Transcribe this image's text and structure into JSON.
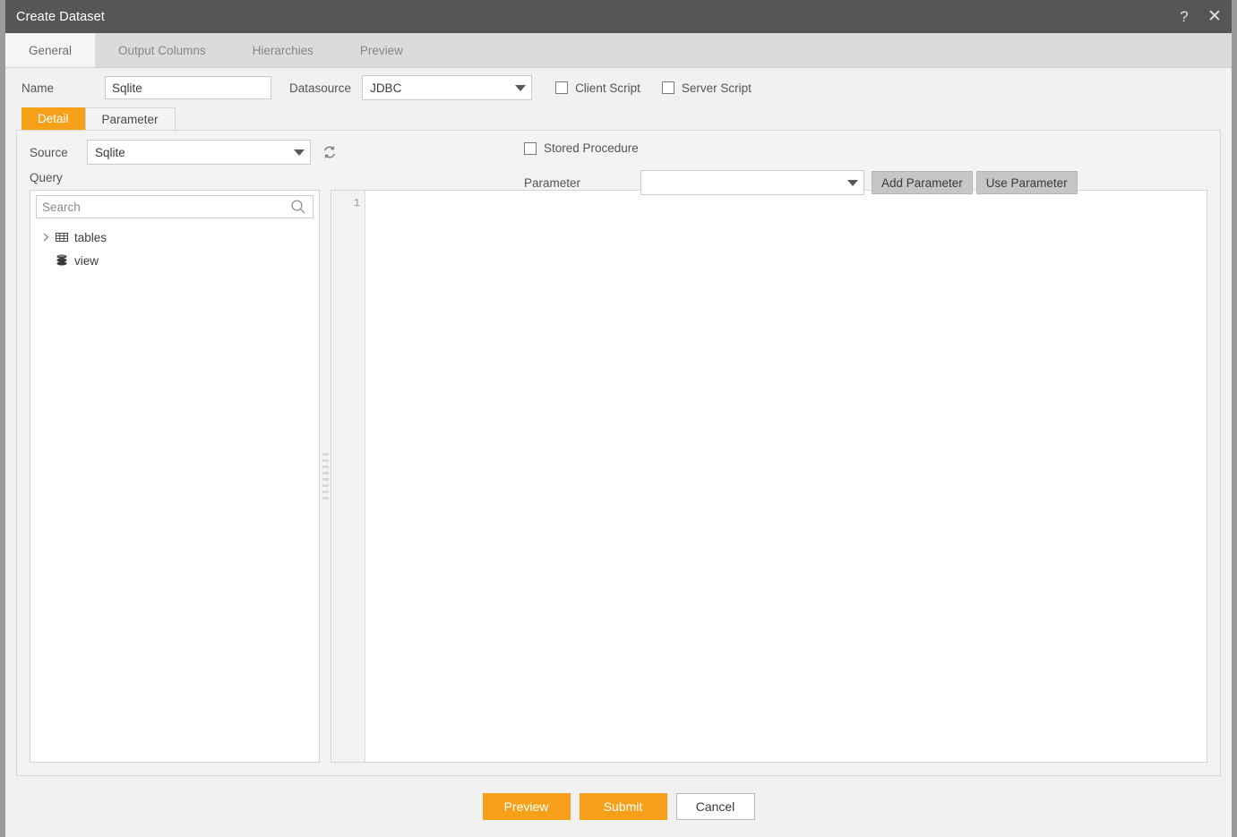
{
  "window": {
    "title": "Create Dataset",
    "help_icon": "question-mark-icon",
    "close_icon": "close-icon"
  },
  "tabs": [
    {
      "label": "General",
      "active": true
    },
    {
      "label": "Output Columns",
      "active": false
    },
    {
      "label": "Hierarchies",
      "active": false
    },
    {
      "label": "Preview",
      "active": false
    }
  ],
  "form": {
    "name_label": "Name",
    "name_value": "Sqlite",
    "datasource_label": "Datasource",
    "datasource_value": "JDBC",
    "client_script_label": "Client Script",
    "client_script_checked": false,
    "server_script_label": "Server Script",
    "server_script_checked": false
  },
  "subtabs": [
    {
      "label": "Detail",
      "active": true
    },
    {
      "label": "Parameter",
      "active": false
    }
  ],
  "detail": {
    "source_label": "Source",
    "source_value": "Sqlite",
    "refresh_icon": "refresh-icon",
    "query_label": "Query",
    "stored_procedure_label": "Stored Procedure",
    "stored_procedure_checked": false,
    "parameter_label": "Parameter",
    "parameter_value": "",
    "add_parameter_label": "Add Parameter",
    "use_parameter_label": "Use Parameter"
  },
  "tree_panel": {
    "search_placeholder": "Search",
    "search_value": "",
    "search_icon": "search-icon",
    "nodes": [
      {
        "label": "tables",
        "icon": "table-grid-icon",
        "expandable": true,
        "expanded": false
      },
      {
        "label": "view",
        "icon": "database-stack-icon",
        "expandable": false,
        "expanded": false
      }
    ]
  },
  "editor": {
    "line_numbers": [
      "1"
    ],
    "code": ""
  },
  "footer": {
    "preview_label": "Preview",
    "submit_label": "Submit",
    "cancel_label": "Cancel"
  },
  "colors": {
    "accent": "#f6a019",
    "titlebar": "#565656",
    "panel_bg": "#f1f1f1",
    "tabstrip": "#dbdbdb"
  }
}
